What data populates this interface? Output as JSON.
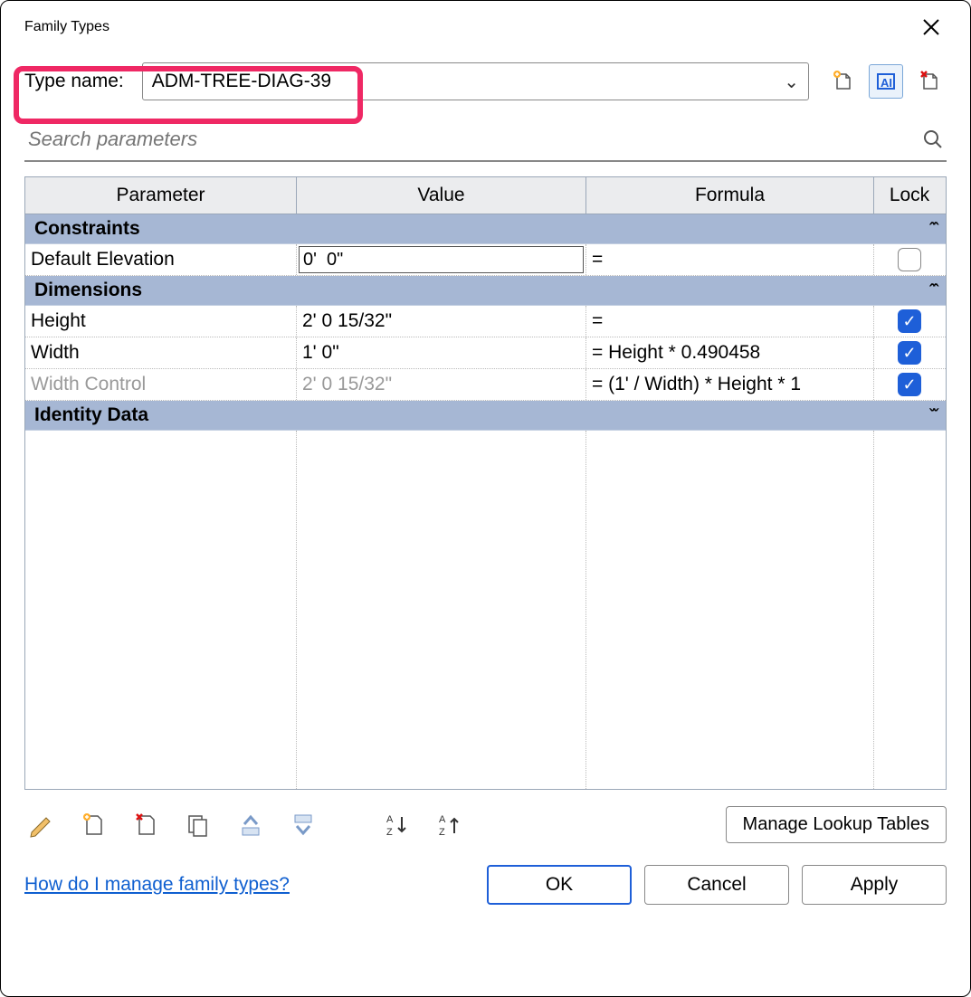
{
  "dialog": {
    "title": "Family Types"
  },
  "typename": {
    "label": "Type name:",
    "value": "ADM-TREE-DIAG-39"
  },
  "typeicons": {
    "new": "new-type",
    "rename": "rename-type",
    "delete": "delete-type"
  },
  "search": {
    "placeholder": "Search parameters"
  },
  "columns": {
    "parameter": "Parameter",
    "value": "Value",
    "formula": "Formula",
    "lock": "Lock"
  },
  "groups": {
    "constraints": {
      "label": "Constraints",
      "expanded": true
    },
    "dimensions": {
      "label": "Dimensions",
      "expanded": true
    },
    "identity": {
      "label": "Identity Data",
      "expanded": false
    }
  },
  "rows": {
    "default_elev": {
      "name": "Default Elevation",
      "value": "0'  0\"",
      "formula": "=",
      "locked": false,
      "editable": true
    },
    "height": {
      "name": "Height",
      "value": "2'  0 15/32\"",
      "formula": "=",
      "locked": true
    },
    "width": {
      "name": "Width",
      "value": "1'  0\"",
      "formula": "= Height * 0.490458",
      "locked": true
    },
    "width_ctrl": {
      "name": "Width Control",
      "value": "2'  0 15/32\"",
      "formula": "= (1' / Width) * Height * 1",
      "locked": true,
      "disabled": true
    }
  },
  "toolbar": {
    "manage_lookup": "Manage Lookup Tables"
  },
  "footer": {
    "help": "How do I manage family types?",
    "ok": "OK",
    "cancel": "Cancel",
    "apply": "Apply"
  }
}
